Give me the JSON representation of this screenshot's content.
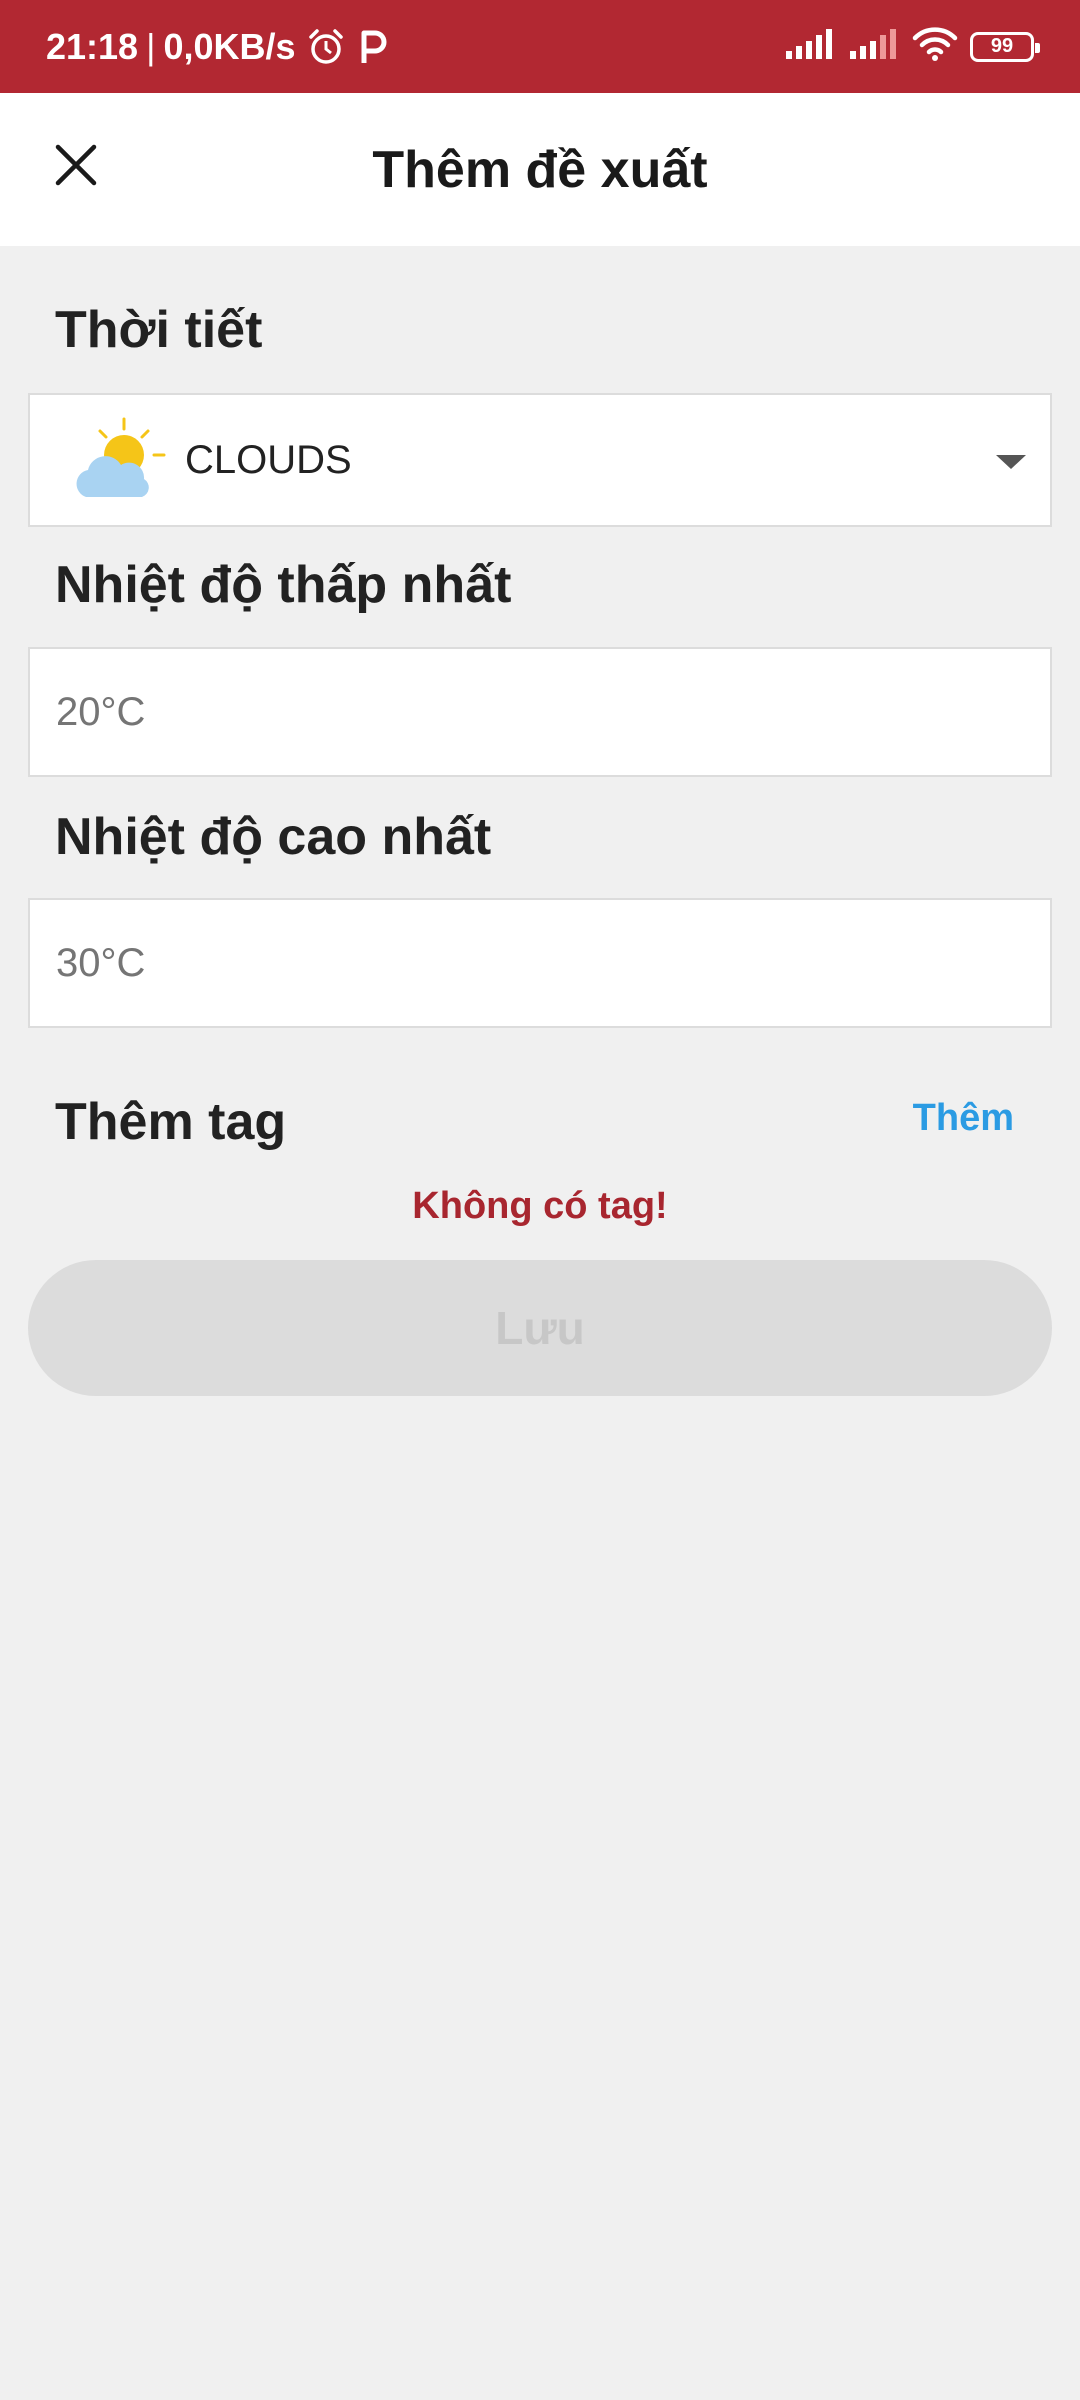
{
  "status_bar": {
    "time": "21:18",
    "separator": "|",
    "speed": "0,0KB/s",
    "battery": "99",
    "icons": [
      "alarm-icon",
      "parking-icon",
      "signal-icon",
      "signal-icon",
      "wifi-icon",
      "battery-icon"
    ]
  },
  "header": {
    "title": "Thêm đề xuất",
    "close_icon": "close-icon"
  },
  "weather": {
    "label": "Thời tiết",
    "selected": "CLOUDS",
    "icon": "sun-cloud-icon"
  },
  "min_temp": {
    "label": "Nhiệt độ thấp nhất",
    "placeholder": "20°C"
  },
  "max_temp": {
    "label": "Nhiệt độ cao nhất",
    "placeholder": "30°C"
  },
  "tags": {
    "label": "Thêm tag",
    "add_label": "Thêm",
    "empty_message": "Không có tag!"
  },
  "save_button": {
    "label": "Lưu",
    "enabled": false
  },
  "colors": {
    "status_bar": "#b22832",
    "accent_link": "#2b9be3",
    "error_text": "#a8262f",
    "background": "#f0f0f0"
  }
}
